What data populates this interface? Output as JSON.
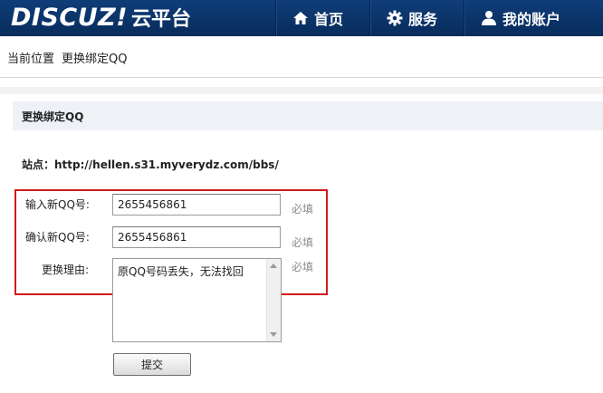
{
  "header": {
    "logo_text": "DISCUZ!",
    "logo_sub": "云平台",
    "nav": [
      {
        "label": "首页",
        "icon": "home-icon"
      },
      {
        "label": "服务",
        "icon": "gear-icon"
      },
      {
        "label": "我的账户",
        "icon": "user-icon"
      }
    ]
  },
  "breadcrumb": {
    "items": [
      "当前位置",
      "更换绑定QQ"
    ]
  },
  "section": {
    "title": "更换绑定QQ"
  },
  "site": {
    "label": "站点：http://hellen.s31.myverydz.com/bbs/"
  },
  "form": {
    "new_qq": {
      "label": "输入新QQ号:",
      "value": "2655456861",
      "required": "必填"
    },
    "confirm_qq": {
      "label": "确认新QQ号:",
      "value": "2655456861",
      "required": "必填"
    },
    "reason": {
      "label": "更换理由:",
      "value": "原QQ号码丢失，无法找回",
      "required": "必填"
    },
    "submit_label": "提交"
  },
  "colors": {
    "header_bg": "#0f3d78",
    "highlight_border": "#d11a1a",
    "section_bg": "#eef2f6"
  }
}
